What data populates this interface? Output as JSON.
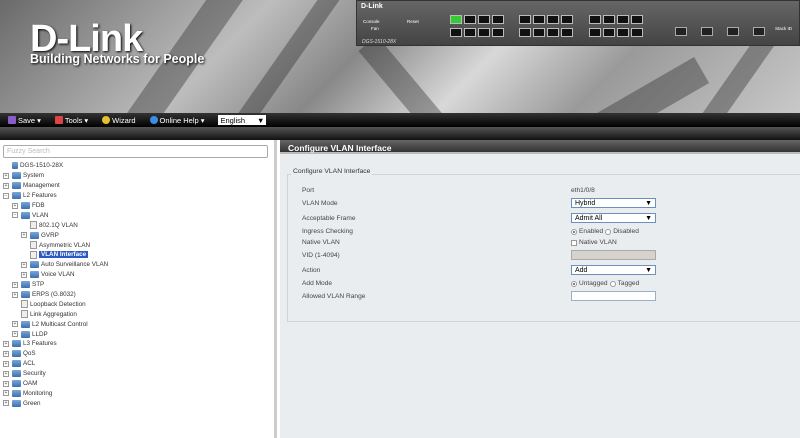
{
  "header": {
    "logo": "D-Link",
    "tagline": "Building Networks for People",
    "device_brand": "D-Link",
    "device_model": "DGS-1510-28X",
    "device_labels": {
      "console": "Console",
      "fan": "Fan",
      "reset": "Reset",
      "stack_id": "Stack ID"
    }
  },
  "toolbar": {
    "save": "Save",
    "tools": "Tools",
    "wizard": "Wizard",
    "help": "Online Help",
    "language": "English"
  },
  "sidebar": {
    "search_placeholder": "Fuzzy Search",
    "tree": [
      {
        "label": "DGS-1510-28X",
        "level": 0,
        "type": "root"
      },
      {
        "label": "System",
        "level": 0,
        "type": "folder",
        "toggle": "+"
      },
      {
        "label": "Management",
        "level": 0,
        "type": "folder",
        "toggle": "+"
      },
      {
        "label": "L2 Features",
        "level": 0,
        "type": "folder",
        "toggle": "-"
      },
      {
        "label": "FDB",
        "level": 1,
        "type": "folder",
        "toggle": "+"
      },
      {
        "label": "VLAN",
        "level": 1,
        "type": "folder",
        "toggle": "-"
      },
      {
        "label": "802.1Q VLAN",
        "level": 2,
        "type": "page"
      },
      {
        "label": "GVRP",
        "level": 2,
        "type": "folder",
        "toggle": "+"
      },
      {
        "label": "Asymmetric VLAN",
        "level": 2,
        "type": "page"
      },
      {
        "label": "VLAN Interface",
        "level": 2,
        "type": "page",
        "selected": true
      },
      {
        "label": "Auto Surveillance VLAN",
        "level": 2,
        "type": "folder",
        "toggle": "+"
      },
      {
        "label": "Voice VLAN",
        "level": 2,
        "type": "folder",
        "toggle": "+"
      },
      {
        "label": "STP",
        "level": 1,
        "type": "folder",
        "toggle": "+"
      },
      {
        "label": "ERPS (G.8032)",
        "level": 1,
        "type": "folder",
        "toggle": "+"
      },
      {
        "label": "Loopback Detection",
        "level": 1,
        "type": "page"
      },
      {
        "label": "Link Aggregation",
        "level": 1,
        "type": "page"
      },
      {
        "label": "L2 Multicast Control",
        "level": 1,
        "type": "folder",
        "toggle": "+"
      },
      {
        "label": "LLDP",
        "level": 1,
        "type": "folder",
        "toggle": "+"
      },
      {
        "label": "L3 Features",
        "level": 0,
        "type": "folder",
        "toggle": "+"
      },
      {
        "label": "QoS",
        "level": 0,
        "type": "folder",
        "toggle": "+"
      },
      {
        "label": "ACL",
        "level": 0,
        "type": "folder",
        "toggle": "+"
      },
      {
        "label": "Security",
        "level": 0,
        "type": "folder",
        "toggle": "+"
      },
      {
        "label": "OAM",
        "level": 0,
        "type": "folder",
        "toggle": "+"
      },
      {
        "label": "Monitoring",
        "level": 0,
        "type": "folder",
        "toggle": "+"
      },
      {
        "label": "Green",
        "level": 0,
        "type": "folder",
        "toggle": "+"
      }
    ]
  },
  "main": {
    "title": "Configure VLAN Interface",
    "section": "Configure VLAN Interface",
    "fields": {
      "port": {
        "label": "Port",
        "value": "eth1/0/8"
      },
      "vlan_mode": {
        "label": "VLAN Mode",
        "value": "Hybrid"
      },
      "acceptable_frame": {
        "label": "Acceptable Frame",
        "value": "Admit All"
      },
      "ingress_checking": {
        "label": "Ingress Checking",
        "opt1": "Enabled",
        "opt2": "Disabled",
        "selected": "Enabled"
      },
      "native_vlan": {
        "label": "Native VLAN",
        "checkbox": "Native VLAN",
        "checked": false
      },
      "vid": {
        "label": "VID (1-4094)",
        "value": ""
      },
      "action": {
        "label": "Action",
        "value": "Add"
      },
      "add_mode": {
        "label": "Add Mode",
        "opt1": "Untagged",
        "opt2": "Tagged",
        "selected": "Untagged"
      },
      "allowed_vlan_range": {
        "label": "Allowed VLAN Range",
        "value": ""
      }
    }
  }
}
